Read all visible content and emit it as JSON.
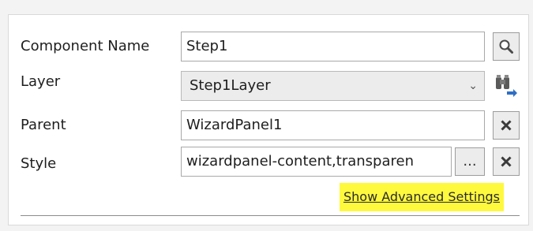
{
  "form": {
    "component_name": {
      "label": "Component Name",
      "value": "Step1"
    },
    "layer": {
      "label": "Layer",
      "value": "Step1Layer"
    },
    "parent": {
      "label": "Parent",
      "value": "WizardPanel1"
    },
    "style": {
      "label": "Style",
      "value": "wizardpanel-content,transparen",
      "more_label": "..."
    }
  },
  "links": {
    "advanced_settings": "Show Advanced Settings"
  },
  "icons": {
    "lookup": "search-icon",
    "layer_navigate": "binoculars-arrow-icon",
    "clear": "close-icon",
    "dropdown": "chevron-down-icon"
  },
  "colors": {
    "highlight": "#fff93d",
    "panel_bg": "#ffffff",
    "page_bg": "#f3f3f3"
  }
}
